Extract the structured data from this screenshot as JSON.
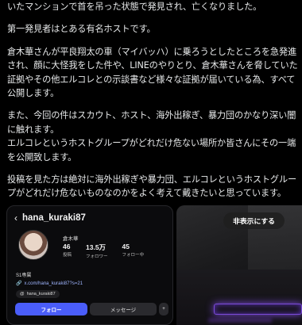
{
  "post": {
    "paragraphs": [
      [
        "いたマンションで首を吊った状態で発見され、亡くなりました。"
      ],
      [
        "第一発見者はとある有名ホストです。"
      ],
      [
        "倉木華さんが平良翔太の車（マイバッハ）に乗ろうとしたところを急発進",
        "され、顔に大怪我をした件や、LINEのやりとり、倉木華さんを脅していた",
        "証拠やその他エルコレとの示談書など様々な証拠が届いている為、すべて",
        "公開します。"
      ],
      [
        "また、今回の件はスカウト、ホスト、海外出稼ぎ、暴力団のかなり深い闇",
        "に触れます。",
        "エルコレというホストグループがどれだけ危ない場所か皆さんにその一端",
        "を公開致します。"
      ],
      [
        "投稿を見た方は絶対に海外出稼ぎや暴力団、エルコレというホストグルー",
        "プがどれだけ危ないものなのかをよく考えて戴きたいと思っています。"
      ]
    ]
  },
  "instagram_card": {
    "back_icon": "chevron-left-icon",
    "username": "hana_kuraki87",
    "display_name": "倉木華",
    "stats": [
      {
        "num": "46",
        "label": "投稿"
      },
      {
        "num": "13.5万",
        "label": "フォロワー"
      },
      {
        "num": "45",
        "label": "フォロー中"
      }
    ],
    "bio": "S1専属",
    "link": "x.com/hana_kuraki87?s=21",
    "threads_handle": "hana_kuraki87",
    "follow_label": "フォロー",
    "message_label": "メッセージ",
    "add_icon": "add-person-icon"
  },
  "media": {
    "hide_label": "非表示にする"
  }
}
